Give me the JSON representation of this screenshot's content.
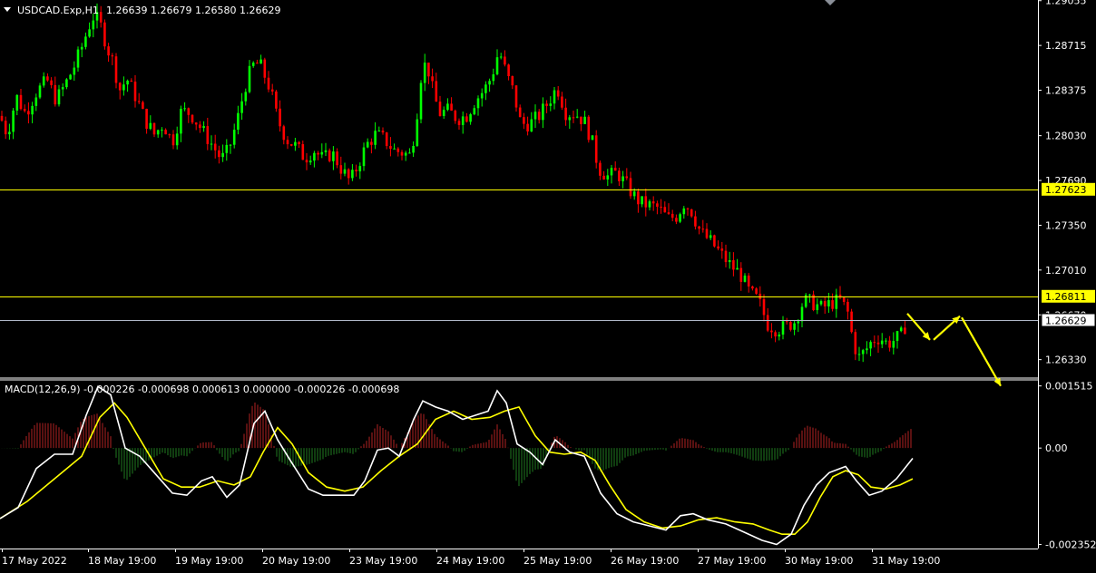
{
  "header": {
    "symbol": "USDCAD.Exp,H1",
    "ohlc": "1.26639 1.26679 1.26580 1.26629"
  },
  "macd": {
    "title": "MACD(12,26,9) -0.000226 -0.000698 0.000613 0.000000 -0.000226 -0.000698"
  },
  "colors": {
    "background": "#000000",
    "bull": "#00ff00",
    "bear": "#ff0000",
    "level": "#ffff00",
    "bid_line": "#b0b8c8",
    "hist_pos": "#b22222",
    "hist_neg": "#1f7a1f",
    "macd_line": "#ffffff",
    "signal_line": "#ffff00",
    "arrow": "#ffff00",
    "axis_text": "#ffffff"
  },
  "chart_data": [
    {
      "type": "candlestick",
      "title": "USDCAD.Exp,H1",
      "y_ticks": [
        "1.29055",
        "1.28715",
        "1.28375",
        "1.28030",
        "1.27690",
        "1.27350",
        "1.27010",
        "1.26670",
        "1.26330"
      ],
      "ylim": [
        1.2619,
        1.2906
      ],
      "x_labels": [
        "17 May 2022",
        "18 May 19:00",
        "19 May 19:00",
        "20 May 19:00",
        "23 May 19:00",
        "24 May 19:00",
        "25 May 19:00",
        "26 May 19:00",
        "27 May 19:00",
        "30 May 19:00",
        "31 May 19:00"
      ],
      "horizontal_levels": [
        {
          "label": "1.27623",
          "value": 1.27623
        },
        {
          "label": "1.26811",
          "value": 1.26811
        }
      ],
      "current_price": {
        "label": "1.26629",
        "value": 1.26629
      },
      "price_path": [
        [
          0,
          1.2818
        ],
        [
          8,
          1.2804
        ],
        [
          18,
          1.2833
        ],
        [
          28,
          1.282
        ],
        [
          40,
          1.2836
        ],
        [
          52,
          1.2845
        ],
        [
          62,
          1.283
        ],
        [
          72,
          1.2842
        ],
        [
          82,
          1.2856
        ],
        [
          90,
          1.287
        ],
        [
          98,
          1.2886
        ],
        [
          104,
          1.2895
        ],
        [
          112,
          1.2885
        ],
        [
          118,
          1.287
        ],
        [
          124,
          1.286
        ],
        [
          132,
          1.2838
        ],
        [
          140,
          1.2846
        ],
        [
          150,
          1.2832
        ],
        [
          160,
          1.2815
        ],
        [
          170,
          1.2804
        ],
        [
          180,
          1.2812
        ],
        [
          190,
          1.2798
        ],
        [
          200,
          1.2822
        ],
        [
          210,
          1.282
        ],
        [
          220,
          1.281
        ],
        [
          232,
          1.2798
        ],
        [
          244,
          1.2785
        ],
        [
          252,
          1.2792
        ],
        [
          262,
          1.2816
        ],
        [
          270,
          1.284
        ],
        [
          278,
          1.2856
        ],
        [
          286,
          1.2858
        ],
        [
          292,
          1.2848
        ],
        [
          298,
          1.2838
        ],
        [
          306,
          1.2815
        ],
        [
          316,
          1.28
        ],
        [
          326,
          1.2795
        ],
        [
          336,
          1.2786
        ],
        [
          346,
          1.2792
        ],
        [
          356,
          1.2785
        ],
        [
          366,
          1.279
        ],
        [
          376,
          1.2778
        ],
        [
          386,
          1.2768
        ],
        [
          394,
          1.278
        ],
        [
          404,
          1.2796
        ],
        [
          414,
          1.2804
        ],
        [
          424,
          1.28
        ],
        [
          434,
          1.2792
        ],
        [
          444,
          1.279
        ],
        [
          452,
          1.2788
        ],
        [
          458,
          1.281
        ],
        [
          464,
          1.2848
        ],
        [
          470,
          1.286
        ],
        [
          476,
          1.284
        ],
        [
          484,
          1.282
        ],
        [
          494,
          1.2822
        ],
        [
          504,
          1.2816
        ],
        [
          514,
          1.2818
        ],
        [
          524,
          1.283
        ],
        [
          534,
          1.2838
        ],
        [
          542,
          1.2848
        ],
        [
          550,
          1.2868
        ],
        [
          558,
          1.285
        ],
        [
          566,
          1.2836
        ],
        [
          574,
          1.2812
        ],
        [
          584,
          1.2812
        ],
        [
          594,
          1.2818
        ],
        [
          604,
          1.2828
        ],
        [
          614,
          1.284
        ],
        [
          624,
          1.282
        ],
        [
          634,
          1.282
        ],
        [
          644,
          1.2814
        ],
        [
          652,
          1.28
        ],
        [
          660,
          1.2778
        ],
        [
          670,
          1.2772
        ],
        [
          680,
          1.2775
        ],
        [
          690,
          1.2766
        ],
        [
          698,
          1.2758
        ],
        [
          706,
          1.2752
        ],
        [
          716,
          1.275
        ],
        [
          726,
          1.2748
        ],
        [
          736,
          1.274
        ],
        [
          746,
          1.2742
        ],
        [
          754,
          1.2752
        ],
        [
          762,
          1.2746
        ],
        [
          772,
          1.273
        ],
        [
          784,
          1.2722
        ],
        [
          796,
          1.2712
        ],
        [
          806,
          1.2704
        ],
        [
          816,
          1.2698
        ],
        [
          826,
          1.2684
        ],
        [
          836,
          1.2678
        ],
        [
          846,
          1.266
        ],
        [
          856,
          1.2656
        ],
        [
          866,
          1.2658
        ],
        [
          876,
          1.2662
        ],
        [
          886,
          1.2678
        ],
        [
          896,
          1.2676
        ],
        [
          906,
          1.2672
        ],
        [
          916,
          1.2676
        ],
        [
          926,
          1.2678
        ],
        [
          934,
          1.267
        ],
        [
          940,
          1.2648
        ],
        [
          946,
          1.2634
        ],
        [
          954,
          1.264
        ],
        [
          962,
          1.2648
        ],
        [
          970,
          1.265
        ],
        [
          978,
          1.2645
        ],
        [
          986,
          1.2648
        ],
        [
          994,
          1.2652
        ],
        [
          1000,
          1.2663
        ]
      ],
      "projection_arrows": [
        [
          [
            1000,
            1.2668
          ],
          [
            1025,
            1.2648
          ]
        ],
        [
          [
            1029,
            1.2648
          ],
          [
            1058,
            1.2666
          ]
        ],
        [
          [
            1060,
            1.2665
          ],
          [
            1103,
            1.2613
          ]
        ]
      ]
    },
    {
      "type": "histogram+line",
      "title": "MACD(12,26,9)",
      "y_ticks": [
        "0.001515",
        "0.00",
        "-0.002352"
      ],
      "ylim": [
        -0.00245,
        0.00164
      ],
      "macd": [
        [
          0,
          -0.00172
        ],
        [
          20,
          -0.00145
        ],
        [
          40,
          -0.0005
        ],
        [
          60,
          -0.00015
        ],
        [
          80,
          -0.00015
        ],
        [
          95,
          0.0008
        ],
        [
          108,
          0.0015
        ],
        [
          122,
          0.0013
        ],
        [
          138,
          0.0
        ],
        [
          154,
          -0.0002
        ],
        [
          170,
          -0.0006
        ],
        [
          190,
          -0.0011
        ],
        [
          206,
          -0.00115
        ],
        [
          222,
          -0.0008
        ],
        [
          234,
          -0.0007
        ],
        [
          250,
          -0.0012
        ],
        [
          264,
          -0.0009
        ],
        [
          280,
          0.0006
        ],
        [
          292,
          0.0009
        ],
        [
          306,
          0.0002
        ],
        [
          320,
          -0.0003
        ],
        [
          340,
          -0.001
        ],
        [
          356,
          -0.00115
        ],
        [
          372,
          -0.00115
        ],
        [
          390,
          -0.00115
        ],
        [
          402,
          -0.0008
        ],
        [
          416,
          -5e-05
        ],
        [
          428,
          0.0
        ],
        [
          440,
          -0.0002
        ],
        [
          456,
          0.0007
        ],
        [
          466,
          0.00115
        ],
        [
          480,
          0.001
        ],
        [
          494,
          0.0009
        ],
        [
          510,
          0.0007
        ],
        [
          524,
          0.0008
        ],
        [
          538,
          0.0009
        ],
        [
          548,
          0.0014
        ],
        [
          558,
          0.0011
        ],
        [
          570,
          0.0001
        ],
        [
          584,
          -0.0001
        ],
        [
          598,
          -0.0004
        ],
        [
          612,
          0.0002
        ],
        [
          628,
          -0.0001
        ],
        [
          644,
          -0.0002
        ],
        [
          662,
          -0.0011
        ],
        [
          680,
          -0.0016
        ],
        [
          698,
          -0.0018
        ],
        [
          716,
          -0.0019
        ],
        [
          734,
          -0.002
        ],
        [
          750,
          -0.00165
        ],
        [
          764,
          -0.0016
        ],
        [
          780,
          -0.00175
        ],
        [
          800,
          -0.00185
        ],
        [
          820,
          -0.00205
        ],
        [
          840,
          -0.00225
        ],
        [
          856,
          -0.00235
        ],
        [
          872,
          -0.0021
        ],
        [
          886,
          -0.0014
        ],
        [
          900,
          -0.0009
        ],
        [
          914,
          -0.0006
        ],
        [
          932,
          -0.00045
        ],
        [
          944,
          -0.0008
        ],
        [
          958,
          -0.00115
        ],
        [
          972,
          -0.00105
        ],
        [
          988,
          -0.00075
        ],
        [
          1006,
          -0.00025
        ]
      ],
      "signal": [
        [
          0,
          -0.00172
        ],
        [
          30,
          -0.0013
        ],
        [
          60,
          -0.00075
        ],
        [
          90,
          -0.0002
        ],
        [
          110,
          0.00075
        ],
        [
          126,
          0.0011
        ],
        [
          140,
          0.00075
        ],
        [
          160,
          0.0
        ],
        [
          180,
          -0.00075
        ],
        [
          200,
          -0.00095
        ],
        [
          220,
          -0.00095
        ],
        [
          240,
          -0.0008
        ],
        [
          258,
          -0.0009
        ],
        [
          276,
          -0.0007
        ],
        [
          290,
          -0.0001
        ],
        [
          306,
          0.0005
        ],
        [
          322,
          0.0001
        ],
        [
          340,
          -0.0006
        ],
        [
          360,
          -0.00095
        ],
        [
          380,
          -0.00105
        ],
        [
          400,
          -0.00095
        ],
        [
          420,
          -0.00055
        ],
        [
          440,
          -0.0002
        ],
        [
          460,
          0.0001
        ],
        [
          480,
          0.0007
        ],
        [
          500,
          0.0009
        ],
        [
          520,
          0.0007
        ],
        [
          540,
          0.00075
        ],
        [
          556,
          0.0009
        ],
        [
          572,
          0.001
        ],
        [
          590,
          0.0003
        ],
        [
          606,
          -0.0001
        ],
        [
          622,
          -0.00015
        ],
        [
          640,
          -0.0001
        ],
        [
          656,
          -0.0003
        ],
        [
          672,
          -0.0009
        ],
        [
          690,
          -0.0015
        ],
        [
          710,
          -0.0018
        ],
        [
          730,
          -0.00195
        ],
        [
          750,
          -0.0019
        ],
        [
          770,
          -0.00175
        ],
        [
          790,
          -0.0017
        ],
        [
          810,
          -0.0018
        ],
        [
          830,
          -0.00185
        ],
        [
          848,
          -0.002
        ],
        [
          862,
          -0.0021
        ],
        [
          876,
          -0.0021
        ],
        [
          890,
          -0.0018
        ],
        [
          904,
          -0.0012
        ],
        [
          918,
          -0.0007
        ],
        [
          932,
          -0.00055
        ],
        [
          946,
          -0.00065
        ],
        [
          960,
          -0.00095
        ],
        [
          976,
          -0.001
        ],
        [
          992,
          -0.0009
        ],
        [
          1006,
          -0.00075
        ]
      ]
    }
  ]
}
